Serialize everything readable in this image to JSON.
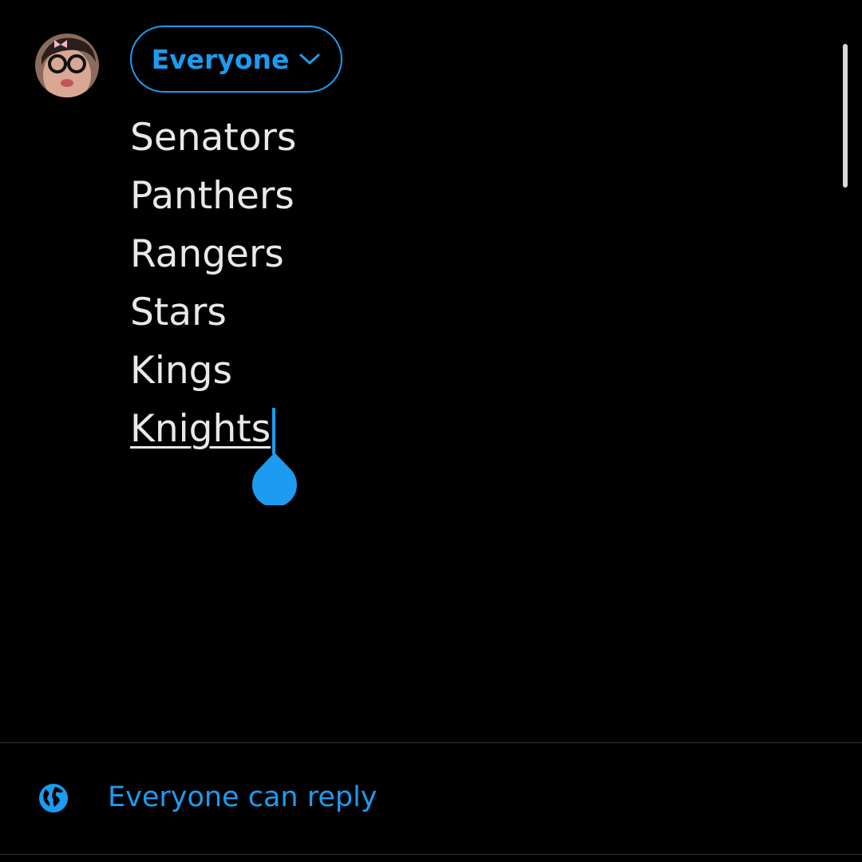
{
  "composer": {
    "audience_label": "Everyone",
    "lines": [
      "Senators",
      "Panthers",
      "Rangers",
      "Stars",
      "Kings",
      "Knights"
    ]
  },
  "reply_settings": {
    "label": "Everyone can reply",
    "icon": "globe-icon"
  },
  "icons": {
    "avatar": "user-avatar",
    "audience_chevron": "chevron-down-icon",
    "caret_handle": "text-cursor-handle-icon"
  },
  "colors": {
    "background": "#000000",
    "accent": "#1d9bf0",
    "text": "#e7e9ea",
    "divider": "#2f3336"
  }
}
